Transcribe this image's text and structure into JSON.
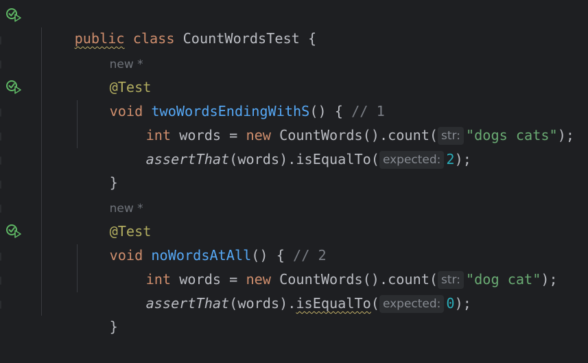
{
  "editor": {
    "class_line": {
      "kw_public": "public",
      "kw_class": "class",
      "class_name": "CountWordsTest",
      "brace": " {"
    },
    "lens_label": "new *",
    "annotation": "@Test",
    "method1": {
      "kw_void": "void",
      "name": "twoWordsEndingWithS",
      "sig": "() { ",
      "comment": "// 1",
      "line1": {
        "kw_int": "int",
        "var": " words = ",
        "kw_new": "new",
        "call": " CountWords().count(",
        "hint": "str:",
        "arg": "\"dogs cats\"",
        "end": ");"
      },
      "line2": {
        "fn": "assertThat",
        "mid": "(words).isEqualTo(",
        "hint": "expected:",
        "arg": "2",
        "end": ");"
      },
      "close": "}"
    },
    "method2": {
      "kw_void": "void",
      "name": "noWordsAtAll",
      "sig": "() { ",
      "comment": "// 2",
      "line1": {
        "kw_int": "int",
        "var": " words = ",
        "kw_new": "new",
        "call": " CountWords().count(",
        "hint": "str:",
        "arg": "\"dog cat\"",
        "end": ");"
      },
      "line2": {
        "fn": "assertThat",
        "mid": "(words).",
        "mid_underlined": "isEqualTo",
        "paren": "(",
        "hint": "expected:",
        "arg": "0",
        "end": ");"
      },
      "close": "}"
    }
  },
  "colors": {
    "background": "#1e1f22",
    "keyword": "#cf8e6d",
    "function": "#56a8f5",
    "annotation": "#b3ae60",
    "string": "#6aab73",
    "number": "#2aacb8",
    "comment": "#7a7e85",
    "run_icon_green": "#5fb865"
  },
  "icons": [
    "run-test-icon"
  ]
}
